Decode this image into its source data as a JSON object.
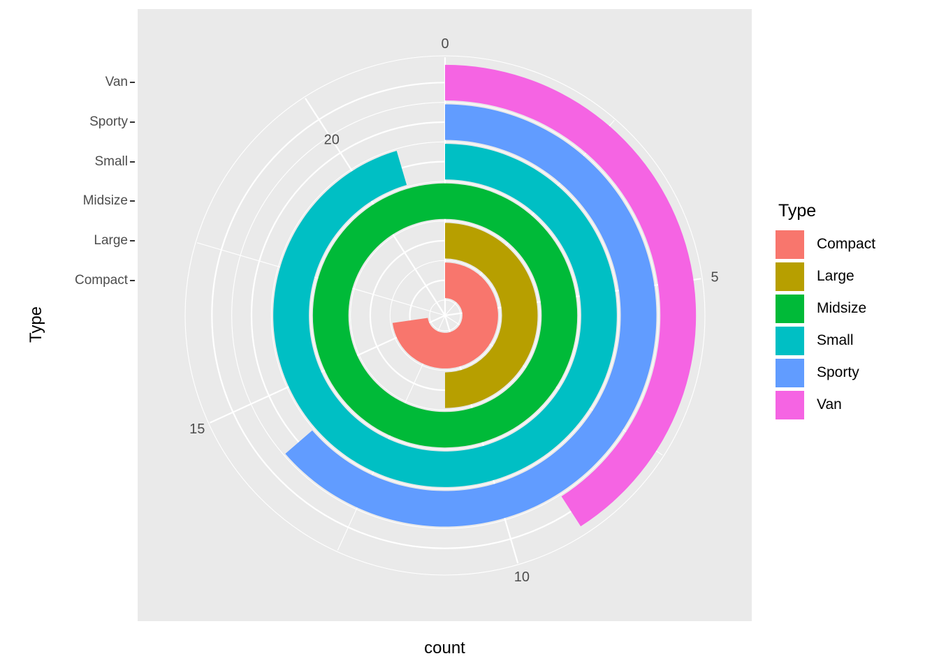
{
  "chart_data": {
    "type": "bar",
    "coordinate_system": "polar",
    "title": "",
    "xlabel": "count",
    "ylabel": "Type",
    "categories": [
      "Compact",
      "Large",
      "Midsize",
      "Small",
      "Sporty",
      "Van"
    ],
    "values": [
      16,
      11,
      22,
      21,
      14,
      9
    ],
    "series": [
      {
        "name": "Compact",
        "value": 16,
        "color": "#f8766d"
      },
      {
        "name": "Large",
        "value": 11,
        "color": "#b79f00"
      },
      {
        "name": "Midsize",
        "value": 22,
        "color": "#00ba38"
      },
      {
        "name": "Small",
        "value": 21,
        "color": "#00bfc4"
      },
      {
        "name": "Sporty",
        "value": 14,
        "color": "#619cff"
      },
      {
        "name": "Van",
        "value": 9,
        "color": "#f564e3"
      }
    ],
    "angular_axis": {
      "label": "count",
      "ticks": [
        0,
        5,
        10,
        15,
        20
      ],
      "tick_labels": [
        "0",
        "5",
        "10",
        "15",
        "20"
      ],
      "range": [
        0,
        22
      ],
      "full_circle_units": 22,
      "start_angle_deg": 0,
      "direction": "clockwise"
    },
    "radial_axis": {
      "label": "Type",
      "tick_labels": [
        "Compact",
        "Large",
        "Midsize",
        "Small",
        "Sporty",
        "Van"
      ]
    },
    "legend": {
      "title": "Type",
      "position": "right",
      "entries": [
        {
          "label": "Compact",
          "color": "#f8766d"
        },
        {
          "label": "Large",
          "color": "#b79f00"
        },
        {
          "label": "Midsize",
          "color": "#00ba38"
        },
        {
          "label": "Small",
          "color": "#00bfc4"
        },
        {
          "label": "Sporty",
          "color": "#619cff"
        },
        {
          "label": "Van",
          "color": "#f564e3"
        }
      ]
    },
    "grid": true,
    "panel_background": "#eaeaea",
    "grid_color": "#ffffff"
  },
  "axes": {
    "x_title": "count",
    "y_title": "Type",
    "y_ticks": [
      {
        "label": "Compact"
      },
      {
        "label": "Large"
      },
      {
        "label": "Midsize"
      },
      {
        "label": "Small"
      },
      {
        "label": "Sporty"
      },
      {
        "label": "Van"
      }
    ],
    "polar_ticks": [
      {
        "label": "0"
      },
      {
        "label": "5"
      },
      {
        "label": "10"
      },
      {
        "label": "15"
      },
      {
        "label": "20"
      }
    ]
  },
  "legend": {
    "title": "Type",
    "items": [
      {
        "label": "Compact"
      },
      {
        "label": "Large"
      },
      {
        "label": "Midsize"
      },
      {
        "label": "Small"
      },
      {
        "label": "Sporty"
      },
      {
        "label": "Van"
      }
    ]
  }
}
